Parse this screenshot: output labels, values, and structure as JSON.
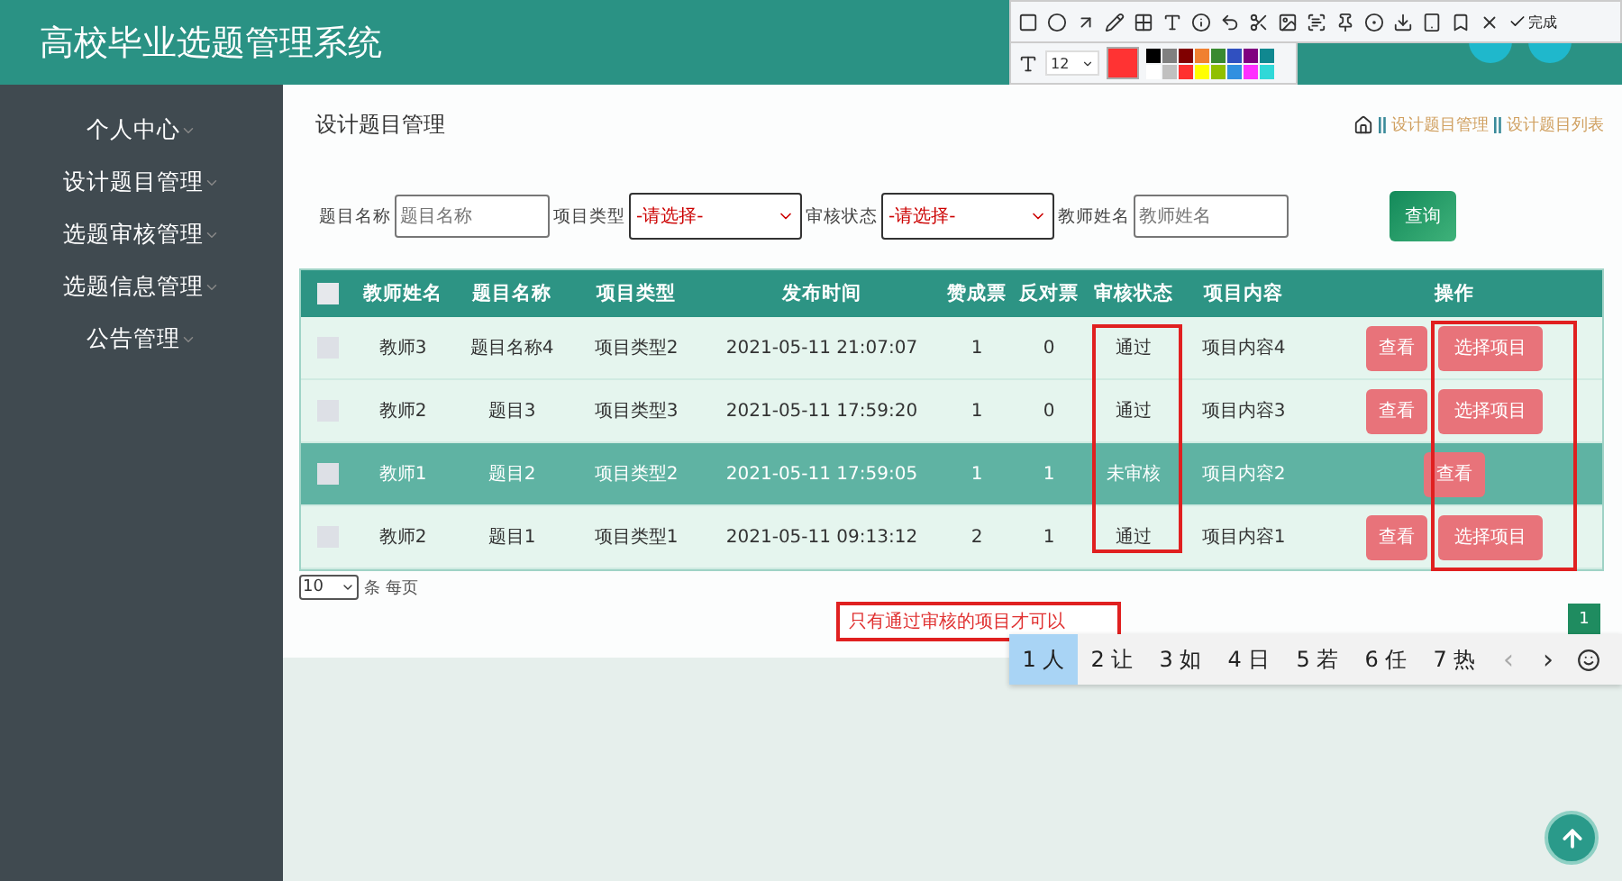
{
  "header": {
    "title": "高校毕业选题管理系统"
  },
  "sidebar": {
    "items": [
      {
        "label": "个人中心"
      },
      {
        "label": "设计题目管理"
      },
      {
        "label": "选题审核管理"
      },
      {
        "label": "选题信息管理"
      },
      {
        "label": "公告管理"
      }
    ]
  },
  "page": {
    "title": "设计题目管理",
    "breadcrumb": [
      "设计题目管理",
      "设计题目列表"
    ]
  },
  "filters": [
    {
      "label": "题目名称",
      "kind": "text",
      "placeholder": "题目名称"
    },
    {
      "label": "项目类型",
      "kind": "select",
      "value": "-请选择-"
    },
    {
      "label": "审核状态",
      "kind": "select",
      "value": "-请选择-"
    },
    {
      "label": "教师姓名",
      "kind": "text",
      "placeholder": "教师姓名"
    }
  ],
  "search_button": "查询",
  "table": {
    "select_all_checked": false,
    "columns": [
      "教师姓名",
      "题目名称",
      "项目类型",
      "发布时间",
      "赞成票",
      "反对票",
      "审核状态",
      "项目内容",
      "操作"
    ],
    "rows": [
      {
        "checked": false,
        "selected": false,
        "cells": [
          "教师3",
          "题目名称4",
          "项目类型2",
          "2021-05-11 21:07:07",
          "1",
          "0",
          "通过",
          "项目内容4"
        ],
        "actions": [
          "查看",
          "选择项目"
        ]
      },
      {
        "checked": false,
        "selected": false,
        "cells": [
          "教师2",
          "题目3",
          "项目类型3",
          "2021-05-11 17:59:20",
          "1",
          "0",
          "通过",
          "项目内容3"
        ],
        "actions": [
          "查看",
          "选择项目"
        ]
      },
      {
        "checked": false,
        "selected": true,
        "cells": [
          "教师1",
          "题目2",
          "项目类型2",
          "2021-05-11 17:59:05",
          "1",
          "1",
          "未审核",
          "项目内容2"
        ],
        "actions": [
          "查看"
        ]
      },
      {
        "checked": false,
        "selected": false,
        "cells": [
          "教师2",
          "题目1",
          "项目类型1",
          "2021-05-11 09:13:12",
          "2",
          "1",
          "通过",
          "项目内容1"
        ],
        "actions": [
          "查看",
          "选择项目"
        ]
      }
    ]
  },
  "pagination": {
    "page_size": "10",
    "page_size_label": "条 每页",
    "pages": [
      {
        "label": "1",
        "selected": true
      }
    ]
  },
  "annotations": [
    {
      "kind": "rectangle"
    },
    {
      "kind": "rectangle"
    },
    {
      "kind": "text",
      "text": "只有通过审核的项目才可以"
    }
  ],
  "screenshot_toolbar": {
    "done_label": "完成",
    "font_size": "12",
    "current_swatch": {
      "color": "#ff3333"
    },
    "palette": [
      {
        "color": "#000000"
      },
      {
        "color": "#808080"
      },
      {
        "color": "#800000"
      },
      {
        "color": "#f08030"
      },
      {
        "color": "#3a8a30"
      },
      {
        "color": "#3050c0"
      },
      {
        "color": "#800080"
      },
      {
        "color": "#108890"
      },
      {
        "color": "#ffffff"
      },
      {
        "color": "#c0c0c0"
      },
      {
        "color": "#ff3030"
      },
      {
        "color": "#ffff00"
      },
      {
        "color": "#90c000"
      },
      {
        "color": "#3090e0"
      },
      {
        "color": "#ff30ff"
      },
      {
        "color": "#30d8d8"
      }
    ]
  },
  "ime": {
    "candidates": [
      {
        "label": "1 人",
        "selected": true
      },
      {
        "label": "2 让",
        "selected": false
      },
      {
        "label": "3 如",
        "selected": false
      },
      {
        "label": "4 日",
        "selected": false
      },
      {
        "label": "5 若",
        "selected": false
      },
      {
        "label": "6 任",
        "selected": false
      },
      {
        "label": "7 热",
        "selected": false
      }
    ],
    "prev": "‹",
    "next": "›"
  }
}
